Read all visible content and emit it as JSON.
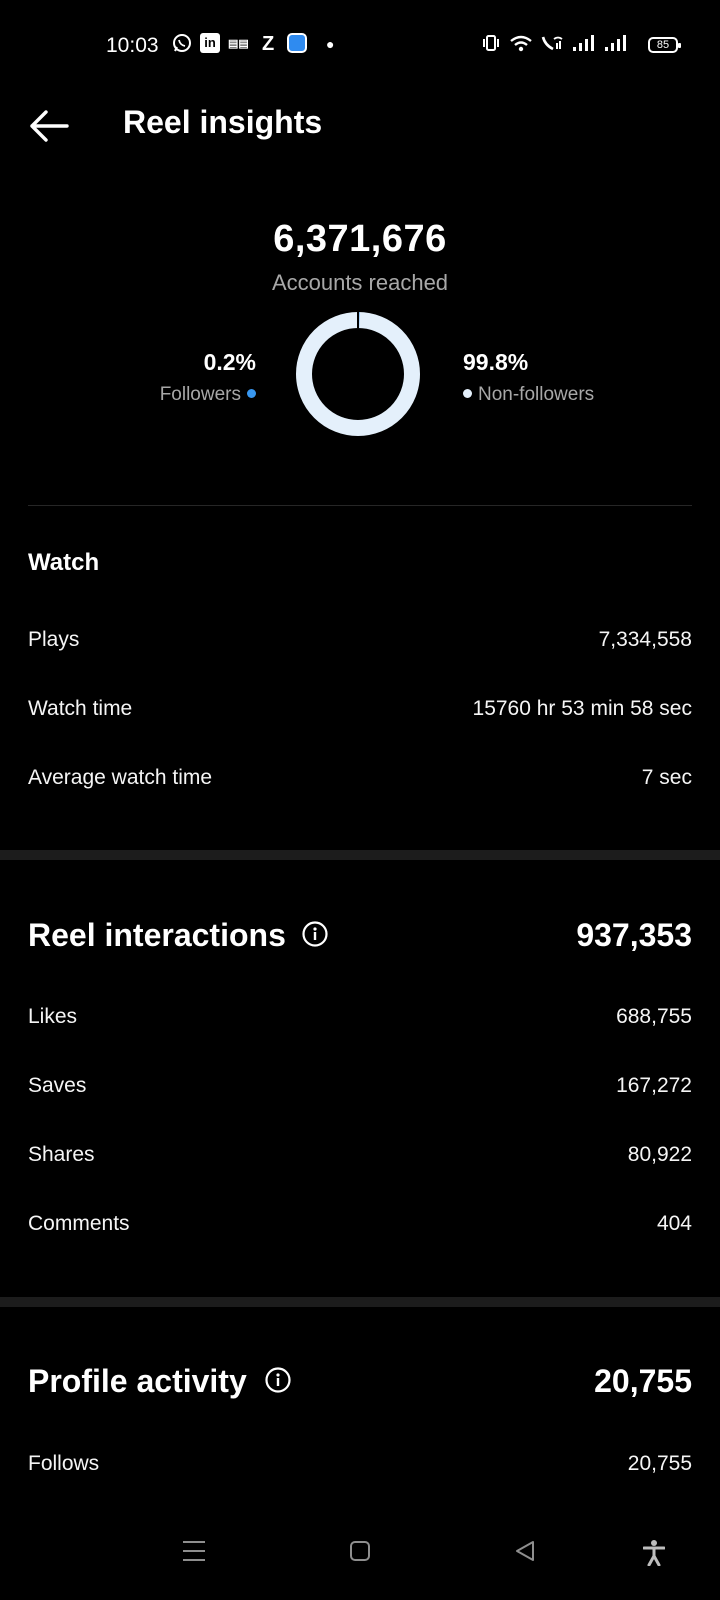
{
  "status_bar": {
    "time": "10:03",
    "battery": "85",
    "left_icons": [
      "whatsapp-icon",
      "linkedin-icon",
      "news-icon",
      "z-icon",
      "app-icon",
      "dot-icon"
    ],
    "right_icons": [
      "vibrate-icon",
      "wifi-icon",
      "wifi-call-icon",
      "signal-icon",
      "signal-icon"
    ]
  },
  "header": {
    "title": "Reel insights"
  },
  "reach": {
    "value": "6,371,676",
    "label": "Accounts reached",
    "followers_pct": "0.2%",
    "followers_label": "Followers",
    "followers_fraction": 0.002,
    "non_followers_pct": "99.8%",
    "non_followers_label": "Non-followers",
    "colors": {
      "followers": "#3897f0",
      "non_followers": "#e4f0fb"
    }
  },
  "watch": {
    "heading": "Watch",
    "rows": [
      {
        "label": "Plays",
        "value": "7,334,558"
      },
      {
        "label": "Watch time",
        "value": "15760 hr 53 min 58 sec"
      },
      {
        "label": "Average watch time",
        "value": "7 sec"
      }
    ]
  },
  "interactions": {
    "heading": "Reel interactions",
    "total": "937,353",
    "rows": [
      {
        "label": "Likes",
        "value": "688,755"
      },
      {
        "label": "Saves",
        "value": "167,272"
      },
      {
        "label": "Shares",
        "value": "80,922"
      },
      {
        "label": "Comments",
        "value": "404"
      }
    ]
  },
  "profile_activity": {
    "heading": "Profile activity",
    "total": "20,755",
    "rows": [
      {
        "label": "Follows",
        "value": "20,755"
      }
    ]
  },
  "nav_bar": {
    "icons": [
      "menu-icon",
      "home-icon",
      "back-icon",
      "accessibility-icon"
    ]
  }
}
